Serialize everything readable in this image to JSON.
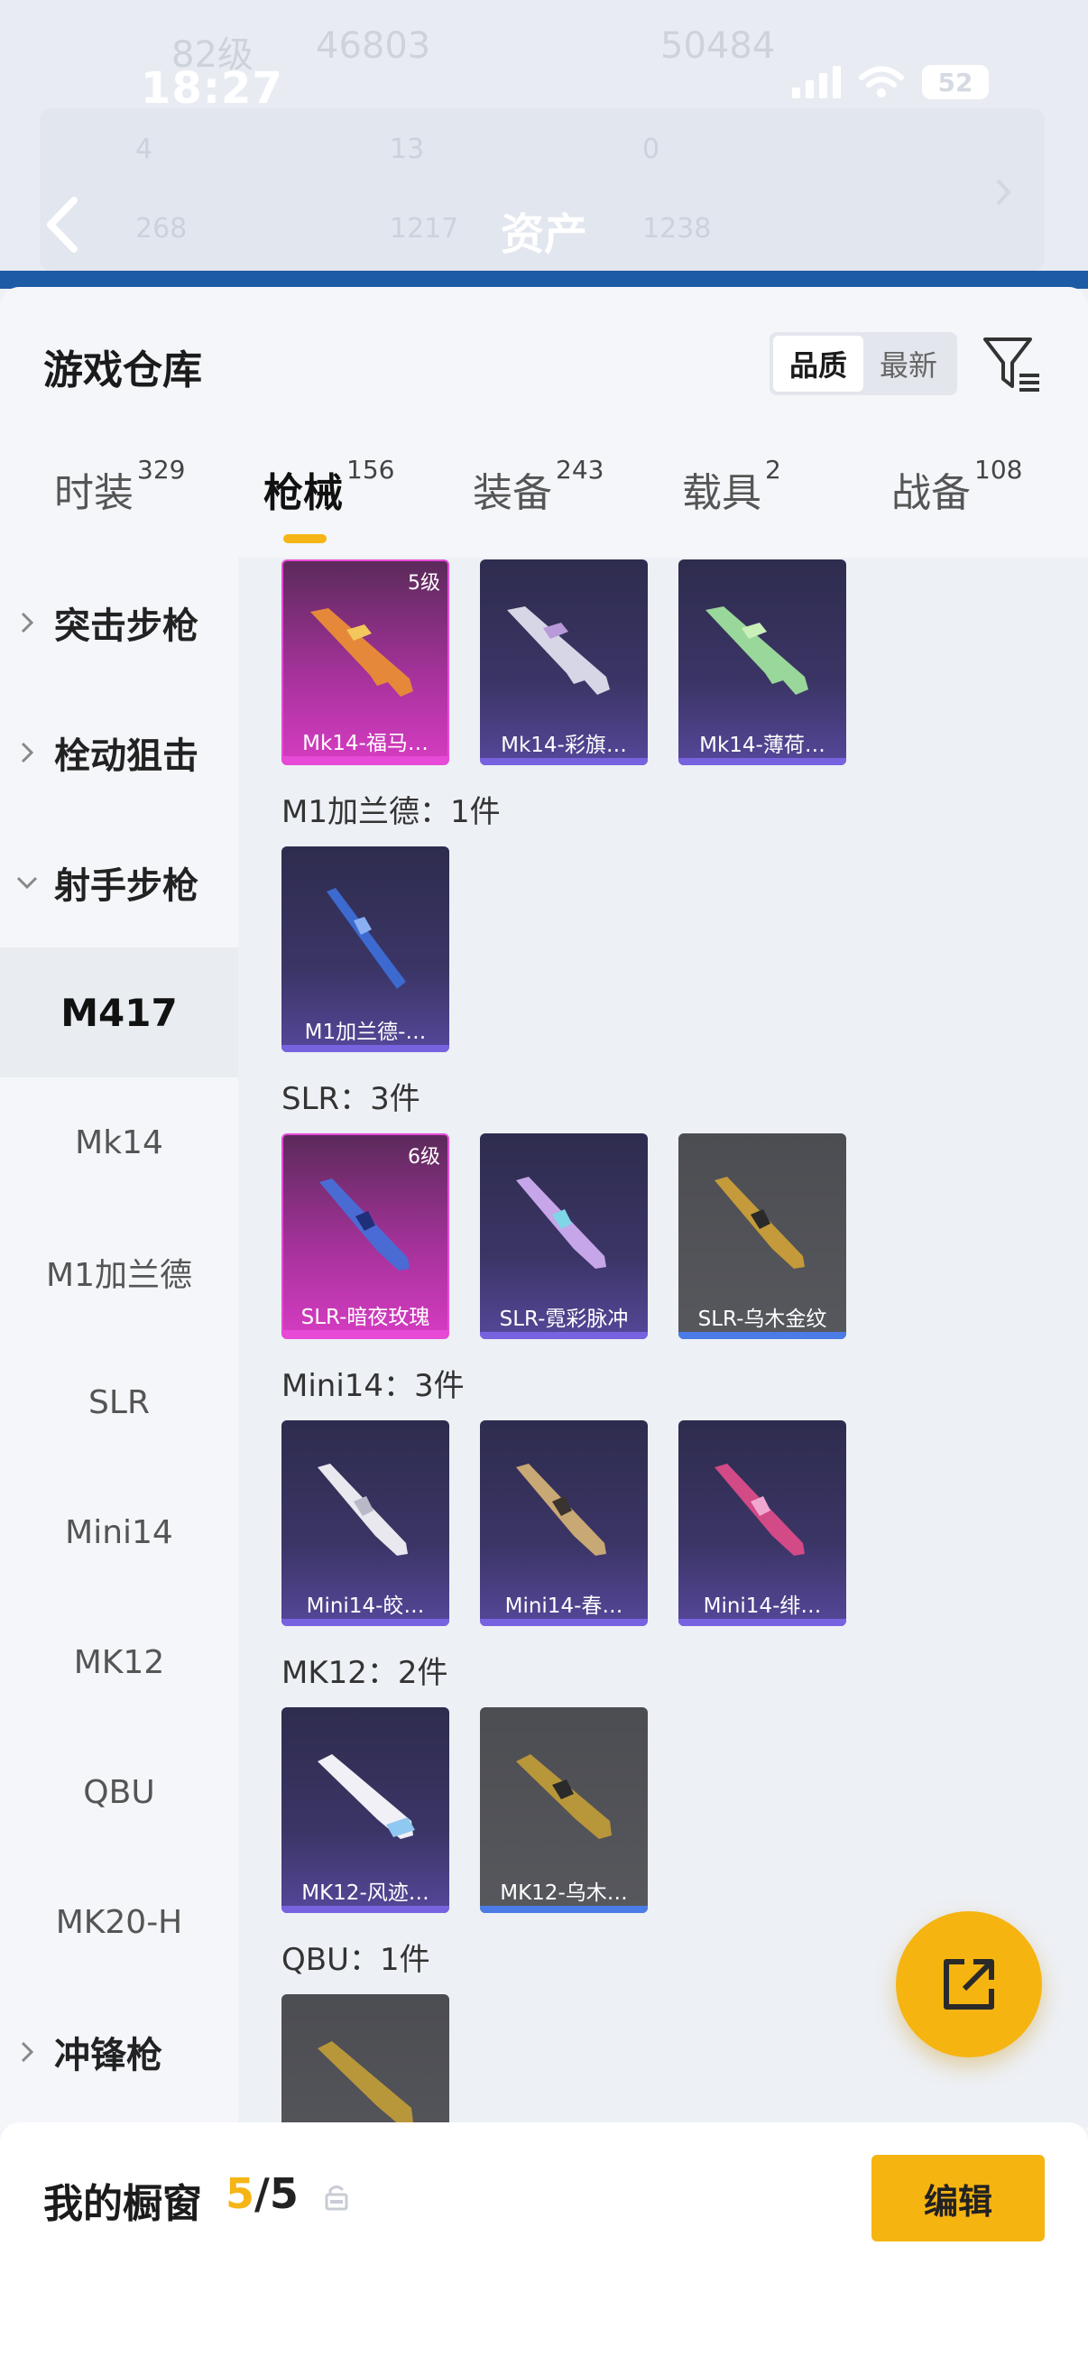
{
  "header": {
    "status_time": "18:27",
    "battery": "52",
    "page_title": "资产",
    "ghost_text": [
      "82级",
      "46803",
      "50484",
      "4",
      "13",
      "0",
      "268",
      "1217",
      "1238"
    ]
  },
  "sheet": {
    "title": "游戏仓库",
    "sort": {
      "quality": "品质",
      "newest": "最新"
    }
  },
  "tabs": [
    {
      "label": "时装",
      "count": "329"
    },
    {
      "label": "枪械",
      "count": "156"
    },
    {
      "label": "装备",
      "count": "243"
    },
    {
      "label": "载具",
      "count": "2"
    },
    {
      "label": "战备",
      "count": "108"
    }
  ],
  "sidebar": {
    "categories": [
      "突击步枪",
      "栓动狙击",
      "射手步枪",
      "冲锋枪"
    ],
    "subitems": [
      "M417",
      "Mk14",
      "M1加兰德",
      "SLR",
      "Mini14",
      "MK12",
      "QBU",
      "MK20-H"
    ]
  },
  "groups": {
    "mk14": {
      "cards": [
        "Mk14-福马…",
        "Mk14-彩旗…",
        "Mk14-薄荷…"
      ],
      "level0": "5级"
    },
    "m1": {
      "label": "M1加兰德：1件",
      "cards": [
        "M1加兰德-…"
      ]
    },
    "slr": {
      "label": "SLR：3件",
      "cards": [
        "SLR-暗夜玫瑰",
        "SLR-霓彩脉冲",
        "SLR-乌木金纹"
      ],
      "level0": "6级"
    },
    "mini14": {
      "label": "Mini14：3件",
      "cards": [
        "Mini14-皎…",
        "Mini14-春…",
        "Mini14-绯…"
      ]
    },
    "mk12": {
      "label": "MK12：2件",
      "cards": [
        "MK12-风迹…",
        "MK12-乌木…"
      ]
    },
    "qbu": {
      "label": "QBU：1件"
    }
  },
  "bottom": {
    "title": "我的橱窗",
    "current": "5",
    "total": "/5",
    "edit": "编辑"
  },
  "colors": {
    "accent": "#f6b411",
    "tab_indicator": "#f5b516",
    "purple_card_bar": "#7763e0",
    "pink_card_bar": "#e64ad6",
    "gray_card_bar": "#4b7be6"
  }
}
